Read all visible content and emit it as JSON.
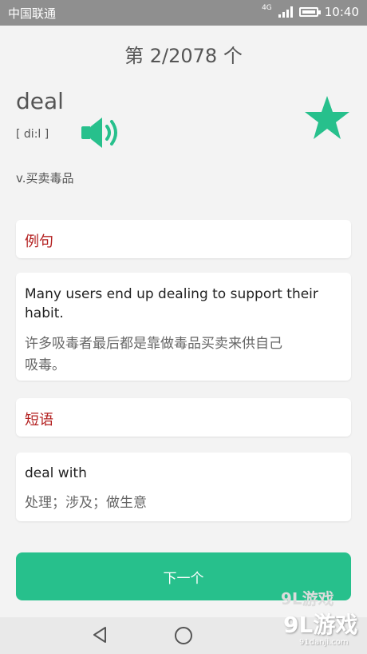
{
  "status_bar": {
    "carrier": "中国联通",
    "network": "4G",
    "time": "10:40",
    "battery_level": 0.9
  },
  "header": {
    "progress": "第 2/2078 个"
  },
  "word": {
    "text": "deal",
    "phonetic": "[ di:l ]",
    "meaning": "v.买卖毒品",
    "starred": true,
    "accent_color": "#27c08c"
  },
  "example": {
    "label": "例句",
    "en_line1": "Many users end up dealing to support their",
    "en_line2": "habit.",
    "zh_line1": "许多吸毒者最后都是靠做毒品买卖来供自己",
    "zh_line2": "吸毒。"
  },
  "phrase": {
    "label": "短语",
    "en": "deal with",
    "zh": "处理；涉及；做生意"
  },
  "next_button": {
    "label": "下一个"
  },
  "nav_bar": {
    "back_icon": "triangle-back-icon",
    "home_icon": "circle-home-icon"
  },
  "watermark": {
    "brand": "9L游戏",
    "url": "91danji.com"
  },
  "colors": {
    "accent": "#27c08c",
    "label_red": "#b31f1f"
  }
}
